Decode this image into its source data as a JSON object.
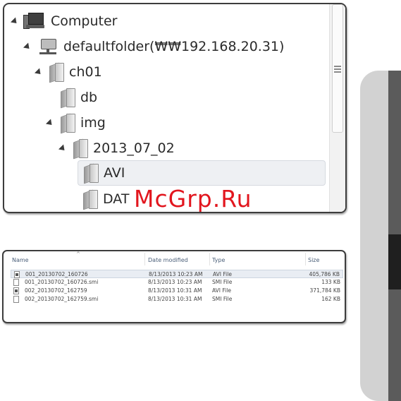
{
  "tree": {
    "items": [
      {
        "label": "Computer",
        "icon": "computer-icon",
        "expanded": true
      },
      {
        "label": "defaultfolder(₩₩192.168.20.31)",
        "icon": "network-drive-icon",
        "expanded": true
      },
      {
        "label": "ch01",
        "icon": "folder-icon",
        "expanded": true
      },
      {
        "label": "db",
        "icon": "folder-icon",
        "expanded": false
      },
      {
        "label": "img",
        "icon": "folder-icon",
        "expanded": true
      },
      {
        "label": "2013_07_02",
        "icon": "folder-icon",
        "expanded": true
      },
      {
        "label": "AVI",
        "icon": "folder-icon",
        "selected": true
      },
      {
        "label": "DAT",
        "icon": "folder-icon"
      }
    ]
  },
  "watermark": "McGrp.Ru",
  "file_list": {
    "columns": [
      "Name",
      "Date modified",
      "Type",
      "Size"
    ],
    "rows": [
      {
        "name": "001_20130702_160726",
        "date": "8/13/2013 10:23 AM",
        "type": "AVI File",
        "size": "405,786 KB",
        "icon": "avi-file-icon"
      },
      {
        "name": "001_20130702_160726.smi",
        "date": "8/13/2013 10:23 AM",
        "type": "SMI File",
        "size": "133 KB",
        "icon": "smi-file-icon"
      },
      {
        "name": "002_20130702_162759",
        "date": "8/13/2013 10:31 AM",
        "type": "AVI File",
        "size": "371,784 KB",
        "icon": "avi-file-icon"
      },
      {
        "name": "002_20130702_162759.smi",
        "date": "8/13/2013 10:31 AM",
        "type": "SMI File",
        "size": "162 KB",
        "icon": "smi-file-icon"
      }
    ]
  },
  "colors": {
    "watermark": "#e2161e",
    "selection": "#eef0f3",
    "side_tab": "#d2d2d2"
  }
}
